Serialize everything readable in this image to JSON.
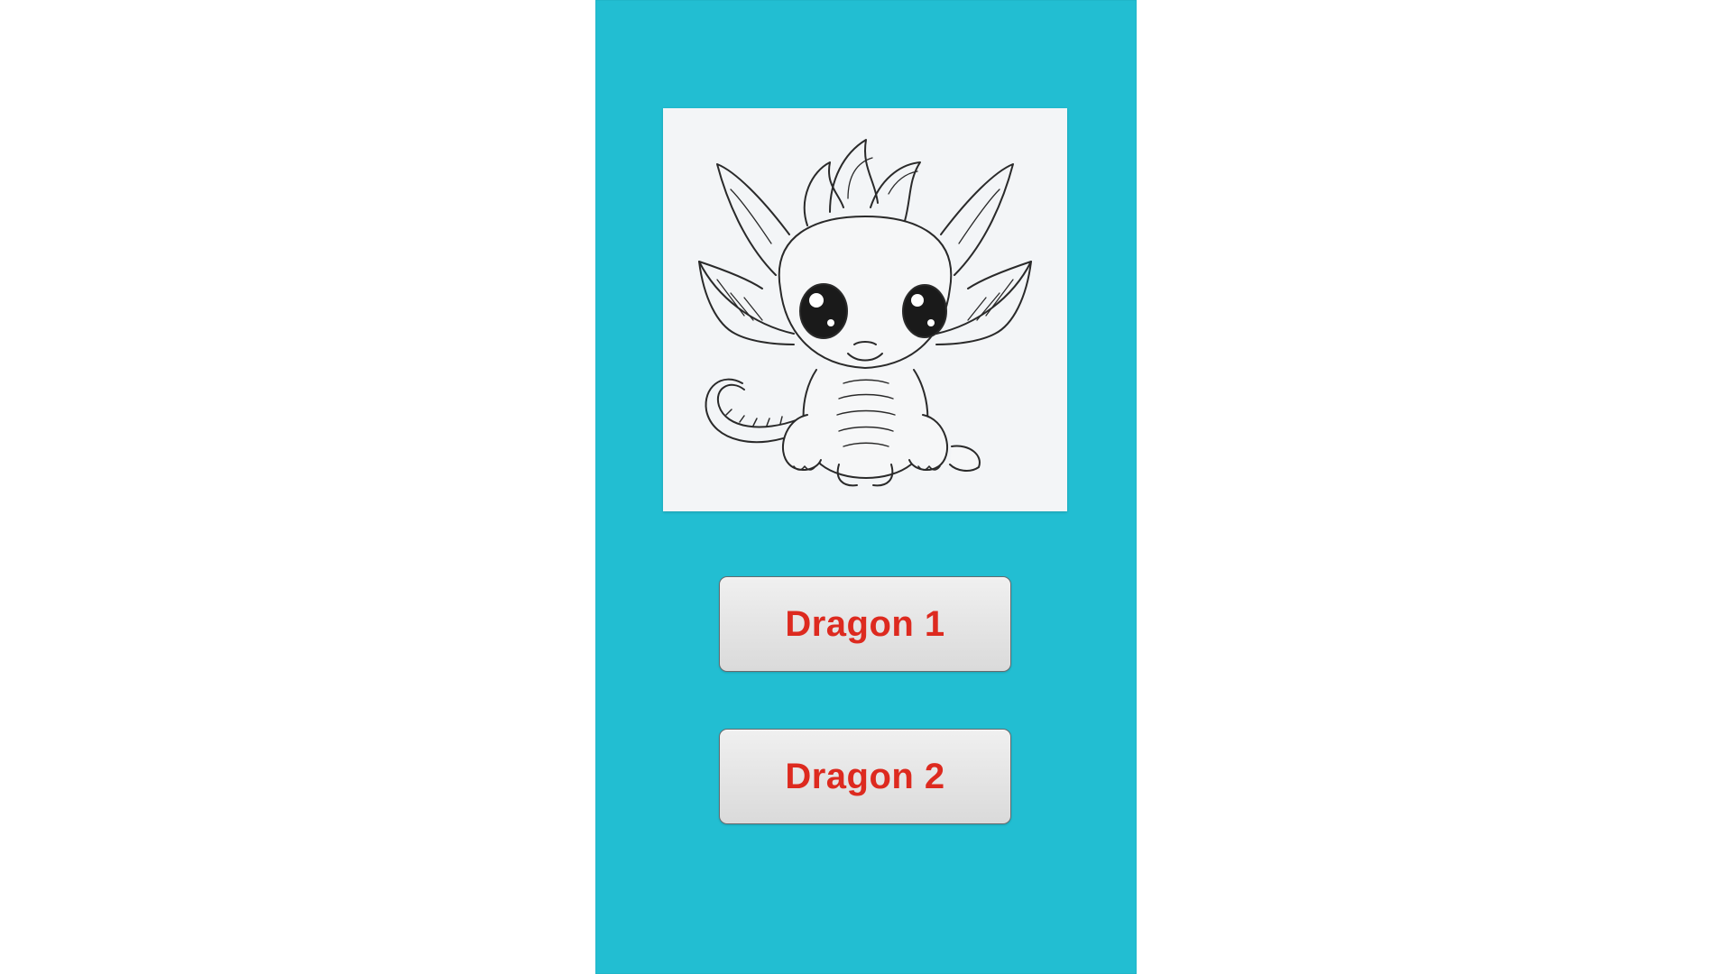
{
  "colors": {
    "page_background": "#ffffff",
    "panel_background": "#22bed2",
    "button_text": "#dd2a1f",
    "button_background": "#e6e6e6"
  },
  "illustration": {
    "subject": "baby-dragon-line-drawing"
  },
  "buttons": [
    {
      "label": "Dragon 1"
    },
    {
      "label": "Dragon 2"
    }
  ]
}
